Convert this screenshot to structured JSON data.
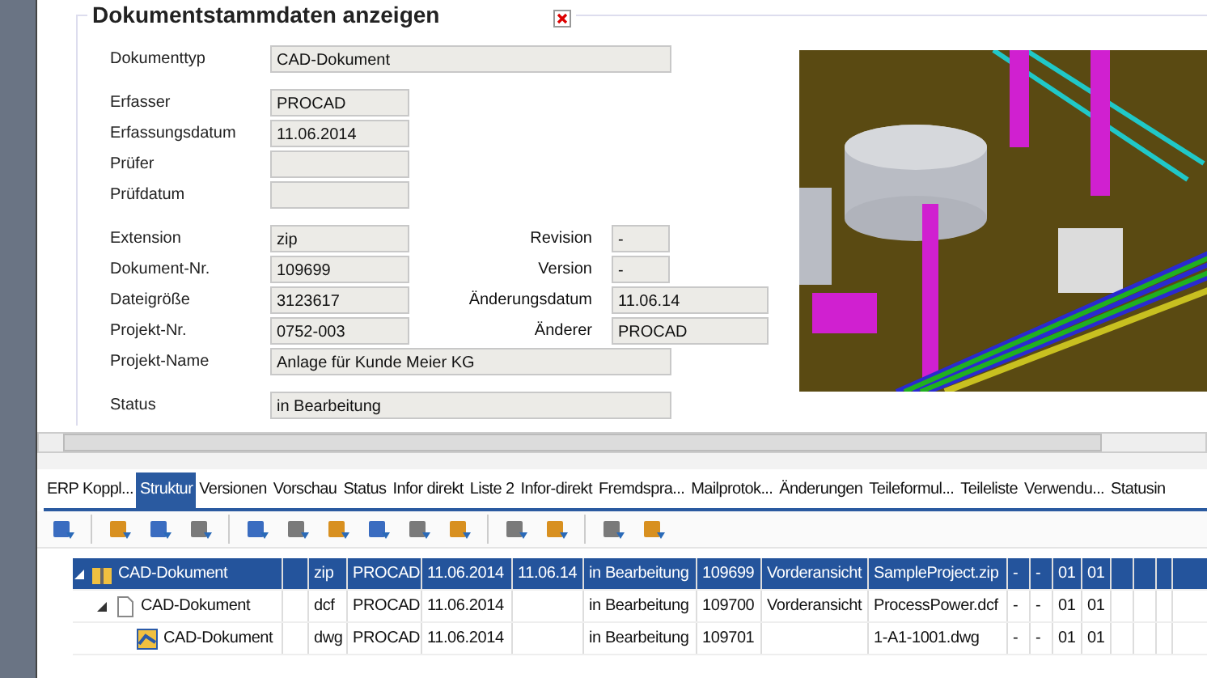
{
  "panel": {
    "title": "Dokumentstammdaten anzeigen"
  },
  "field_groups": [
    [
      {
        "label": "Dokumenttyp",
        "value": "CAD-Dokument",
        "kind": "wide"
      }
    ],
    [
      {
        "label": "Erfasser",
        "value": "PROCAD",
        "kind": "short"
      },
      {
        "label": "Erfassungsdatum",
        "value": "11.06.2014",
        "kind": "short"
      },
      {
        "label": "Prüfer",
        "kind": "short"
      },
      {
        "label": "Prüfdatum",
        "kind": "short"
      }
    ],
    [
      {
        "label": "Extension",
        "value": "zip",
        "kind": "short",
        "right": {
          "label": "Revision",
          "value": "-",
          "kind": "tiny"
        }
      },
      {
        "label": "Dokument-Nr.",
        "value": "109699",
        "kind": "short",
        "right": {
          "label": "Version",
          "value": "-",
          "kind": "tiny"
        }
      },
      {
        "label": "Dateigröße",
        "value": "3123617",
        "kind": "short",
        "right": {
          "label": "Änderungsdatum",
          "value": "11.06.14",
          "kind": "medium"
        }
      },
      {
        "label": "Projekt-Nr.",
        "value": "0752-003",
        "kind": "short",
        "right": {
          "label": "Änderer",
          "value": "PROCAD",
          "kind": "medium"
        }
      },
      {
        "label": "Projekt-Name",
        "value": "Anlage für Kunde Meier KG",
        "kind": "wide"
      }
    ],
    [
      {
        "label": "Status",
        "value": "in Bearbeitung",
        "kind": "wide"
      }
    ]
  ],
  "tabs": [
    {
      "label": "ERP Koppl...",
      "selected": false
    },
    {
      "label": "Struktur",
      "selected": true
    },
    {
      "label": "Versionen",
      "selected": false
    },
    {
      "label": "Vorschau",
      "selected": false
    },
    {
      "label": "Status",
      "selected": false
    },
    {
      "label": "Infor direkt",
      "selected": false
    },
    {
      "label": "Liste 2",
      "selected": false
    },
    {
      "label": "Infor-direkt",
      "selected": false
    },
    {
      "label": "Fremdspra...",
      "selected": false
    },
    {
      "label": "Mailprotok...",
      "selected": false
    },
    {
      "label": "Änderungen",
      "selected": false
    },
    {
      "label": "Teileformul...",
      "selected": false
    },
    {
      "label": "Teileliste",
      "selected": false
    },
    {
      "label": "Verwendu...",
      "selected": false
    },
    {
      "label": "Statusin",
      "selected": false
    }
  ],
  "tree": [
    {
      "kind": "zip",
      "expanded": true,
      "selected": true,
      "cells": [
        "CAD-Dokument",
        "",
        "zip",
        "PROCAD",
        "11.06.2014",
        "11.06.14",
        "in Bearbeitung",
        "109699",
        "Vorderansicht",
        "SampleProject.zip",
        "-",
        "-",
        "01",
        "01",
        "",
        "",
        ""
      ],
      "children": [
        {
          "kind": "doc",
          "expanded": true,
          "selected": false,
          "cells": [
            "CAD-Dokument",
            "",
            "dcf",
            "PROCAD",
            "11.06.2014",
            "",
            "in Bearbeitung",
            "109700",
            "Vorderansicht",
            "ProcessPower.dcf",
            "-",
            "-",
            "01",
            "01",
            "",
            "",
            ""
          ],
          "children": [
            {
              "kind": "cad",
              "selected": false,
              "cells": [
                "CAD-Dokument",
                "",
                "dwg",
                "PROCAD",
                "11.06.2014",
                "",
                "in Bearbeitung",
                "109701",
                "",
                "1-A1-1001.dwg",
                "-",
                "-",
                "01",
                "01",
                "",
                "",
                ""
              ]
            }
          ]
        }
      ]
    }
  ]
}
